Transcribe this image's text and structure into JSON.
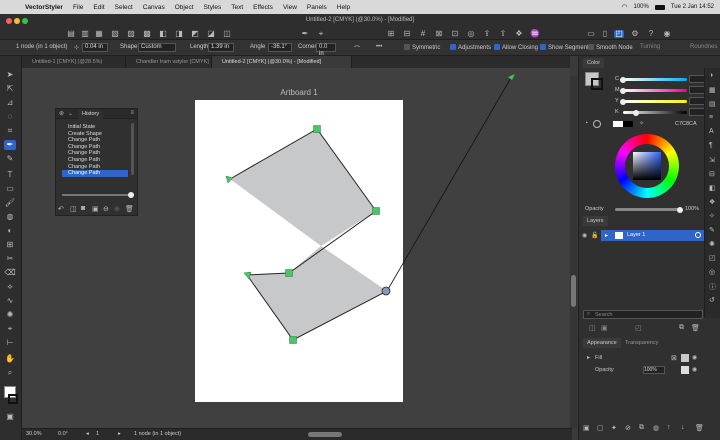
{
  "menubar": {
    "app": "VectorStyler",
    "items": [
      "File",
      "Edit",
      "Select",
      "Canvas",
      "Object",
      "Styles",
      "Text",
      "Effects",
      "View",
      "Panels",
      "Help"
    ],
    "battery": "100%",
    "date": "Tue 2 Jan 14:52"
  },
  "window": {
    "title": "Untitled-2 [CMYK] (@30.0%) - [Modified]"
  },
  "controlbar": {
    "selection": "1 node (in 1 object)",
    "size_value": "0.04 in",
    "shape_label": "Shape",
    "shape_value": "Custom",
    "length_label": "Length",
    "length_value": "1.39 in",
    "angle_label": "Angle",
    "angle_value": "-36.1°",
    "corner_label": "Corner",
    "corner_value": "0.0 in",
    "symmetric": "Symmetric",
    "adjustments": "Adjustments",
    "allow_closing": "Allow Closing",
    "show_segment": "Show Segment",
    "smooth_node": "Smooth Node",
    "turning": "Turning",
    "roundness": "Roundnes"
  },
  "tabs": [
    "Untitled-1 [CMYK] (@28.5%)",
    "Chandler tram vstyler [CMYK]",
    "Untitled-2 [CMYK] (@30.0%) - [Modified]"
  ],
  "artboard": {
    "title": "Artboard 1"
  },
  "history": {
    "title": "History",
    "items": [
      "Initial State",
      "Create Shape",
      "Change Path",
      "Change Path",
      "Change Path",
      "Change Path",
      "Change Path",
      "Change Path"
    ],
    "selected_index": 7
  },
  "statusbar": {
    "zoom": "30.0%",
    "angle": "0.0°",
    "page": "1",
    "selection": "1 node (in 1 object)"
  },
  "color_panel": {
    "tab": "Color",
    "channels": [
      {
        "label": "C",
        "value": "0"
      },
      {
        "label": "M",
        "value": "0"
      },
      {
        "label": "Y",
        "value": "0"
      },
      {
        "label": "K",
        "value": "20"
      }
    ],
    "hex": "C7C8CA",
    "opacity_label": "Opacity",
    "opacity_value": "100%"
  },
  "layers_panel": {
    "tab": "Layers",
    "layer_name": "Layer 1",
    "search_placeholder": "Search"
  },
  "appearance_panel": {
    "tab_appearance": "Appearance",
    "tab_transparency": "Transparency",
    "fill_label": "Fill",
    "opacity_label": "Opacity",
    "opacity_value": "100%"
  },
  "colors": {
    "selection_blue": "#2f64c8",
    "shape_fill": "#c7c8ca",
    "node_green": "#4cc46a"
  }
}
